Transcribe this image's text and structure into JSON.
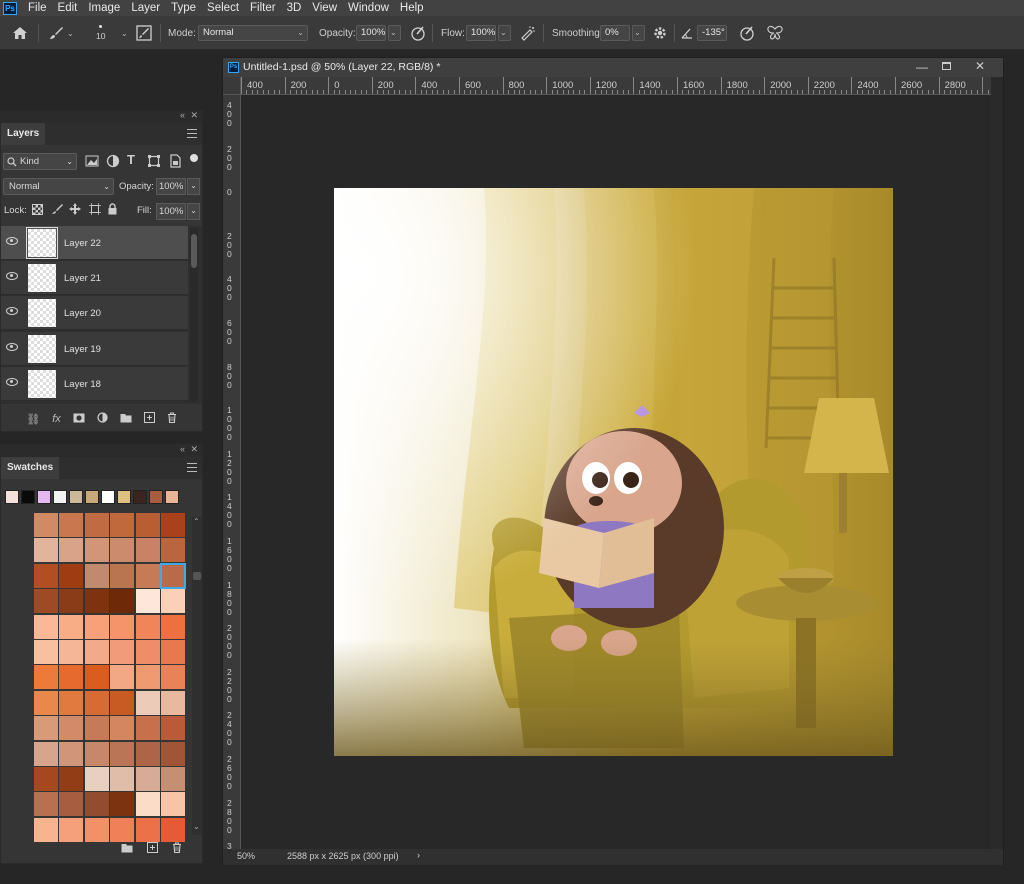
{
  "app": {
    "logo": "Ps",
    "menu": [
      "File",
      "Edit",
      "Image",
      "Layer",
      "Type",
      "Select",
      "Filter",
      "3D",
      "View",
      "Window",
      "Help"
    ]
  },
  "options": {
    "home_icon": "home-icon",
    "brush_icon": "brush-icon",
    "brush_size": "10",
    "mode_label": "Mode:",
    "mode_value": "Normal",
    "opacity_label": "Opacity:",
    "opacity_value": "100%",
    "flow_label": "Flow:",
    "flow_value": "100%",
    "smoothing_label": "Smoothing:",
    "smoothing_value": "0%",
    "angle_value": "-135°"
  },
  "layers_panel": {
    "tab": "Layers",
    "filter_kind": "Kind",
    "blend_mode": "Normal",
    "opacity_label": "Opacity:",
    "opacity_value": "100%",
    "lock_label": "Lock:",
    "fill_label": "Fill:",
    "fill_value": "100%",
    "layers": [
      {
        "name": "Layer 22",
        "selected": true
      },
      {
        "name": "Layer 21",
        "selected": false
      },
      {
        "name": "Layer 20",
        "selected": false
      },
      {
        "name": "Layer 19",
        "selected": false
      },
      {
        "name": "Layer 18",
        "selected": false
      }
    ]
  },
  "swatches_panel": {
    "tab": "Swatches",
    "recent": [
      "#f5e1dc",
      "#0a0a0a",
      "#e6b8f0",
      "#f2f2f2",
      "#cdb99a",
      "#c7a97a",
      "#ffffff",
      "#e0c080",
      "#3b2420",
      "#a85d40",
      "#e8b598"
    ],
    "grid": [
      [
        "#d28a65",
        "#c8774f",
        "#c16b45",
        "#c0693c",
        "#b85e32",
        "#a9421c"
      ],
      [
        "#e2b49b",
        "#d8a389",
        "#d29577",
        "#cd8b6d",
        "#c98266",
        "#b9663f"
      ],
      [
        "#b14f22",
        "#9f3d12",
        "#c28a6d",
        "#b9754f",
        "#c67a56",
        "#b86a49"
      ],
      [
        "#9d4a25",
        "#8a3b17",
        "#7e3210",
        "#6e2a08",
        "#fee6d8",
        "#fbd0b8"
      ],
      [
        "#fbb899",
        "#f9ad86",
        "#f7a07a",
        "#f5946a",
        "#f2845a",
        "#ee6f3f"
      ],
      [
        "#f9c0a0",
        "#f5b597",
        "#f2aa8a",
        "#f29b7a",
        "#ef8d69",
        "#e8794f"
      ],
      [
        "#ed7a3b",
        "#e66a2d",
        "#db5c1f",
        "#f2a884",
        "#f09a72",
        "#e88257"
      ],
      [
        "#e8894b",
        "#e07a3f",
        "#d86b33",
        "#c85a24",
        "#eccbb8",
        "#e8b89f"
      ],
      [
        "#d99a78",
        "#d18b68",
        "#c67a57",
        "#d48660",
        "#c86f4c",
        "#b95a39"
      ],
      [
        "#d6a58b",
        "#cf9679",
        "#c6876a",
        "#ba7556",
        "#ae6547",
        "#9f5536"
      ],
      [
        "#a54820",
        "#933d16",
        "#e8cfc0",
        "#e0bda9",
        "#d7ab95",
        "#c48f73"
      ],
      [
        "#b87050",
        "#a55f40",
        "#924d31",
        "#7a3510",
        "#fbdcc7",
        "#f8c4a7"
      ],
      [
        "#f8b48e",
        "#f5a07a",
        "#f29068",
        "#ef8058",
        "#ec7048",
        "#e65a36"
      ]
    ]
  },
  "document": {
    "title": "Untitled-1.psd @ 50% (Layer 22, RGB/8) *",
    "ruler_h": [
      "400",
      "200",
      "0",
      "200",
      "400",
      "600",
      "800",
      "1000",
      "1200",
      "1400",
      "1600",
      "1800",
      "2000",
      "2200",
      "2400",
      "2600",
      "2800"
    ],
    "ruler_v": [
      "4 0 0",
      "2 0 0",
      "0",
      "2 0 0",
      "4 0 0",
      "6 0 0",
      "8 0 0",
      "1 0 0 0",
      "1 2 0 0",
      "1 4 0 0",
      "1 6 0 0",
      "1 8 0 0",
      "2 0 0 0",
      "2 2 0 0",
      "2 4 0 0",
      "2 6 0 0",
      "2 8 0 0",
      "3"
    ],
    "zoom": "50%",
    "doc_info": "2588 px x 2625 px (300 ppi)",
    "status_arrow": "›"
  },
  "colors": {
    "accent": "#31a8ff",
    "selected_swatch": "#3fa8e8"
  }
}
